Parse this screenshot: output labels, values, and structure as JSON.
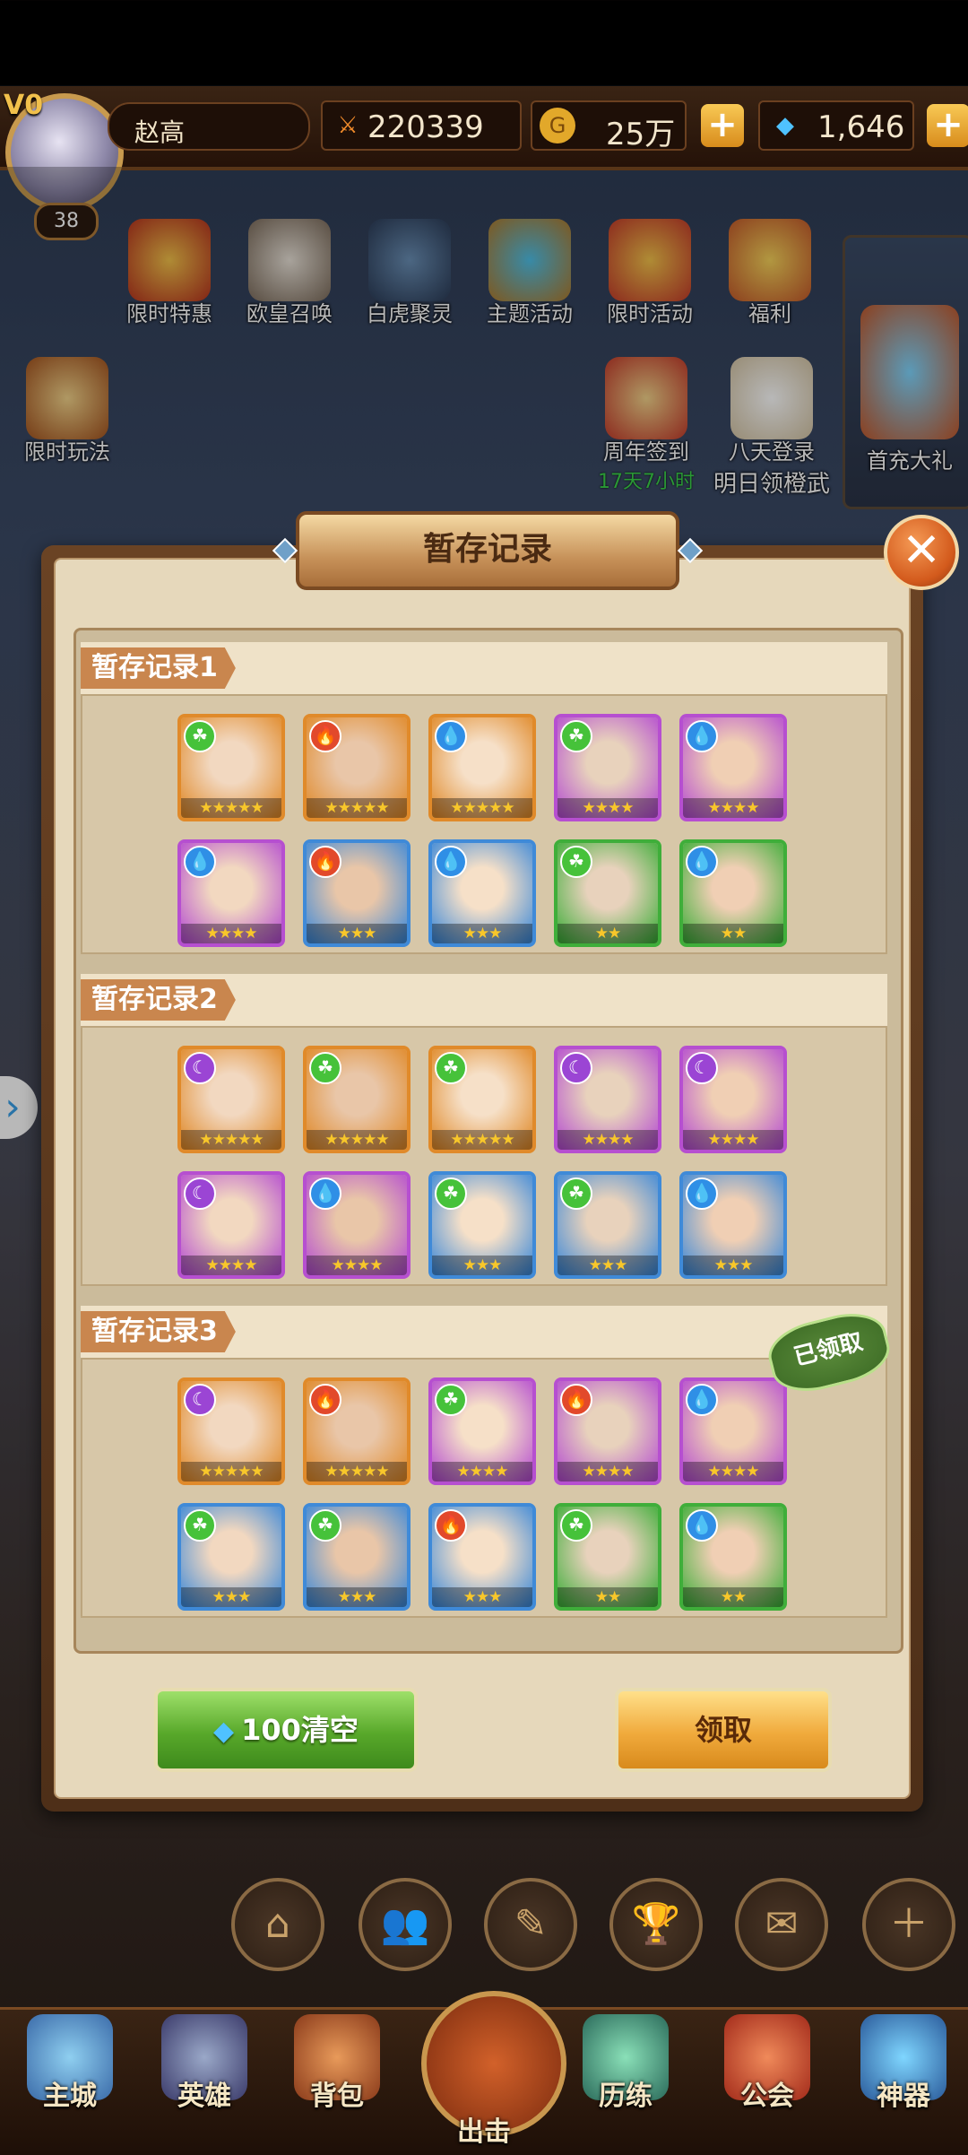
{
  "player": {
    "vip": "V0",
    "name": "赵高",
    "level": "38"
  },
  "resources": {
    "power": "220339",
    "gold": "25万",
    "diamonds": "1,646"
  },
  "activities": [
    {
      "label": "限时特惠"
    },
    {
      "label": "欧皇召唤"
    },
    {
      "label": "白虎聚灵"
    },
    {
      "label": "主题活动"
    },
    {
      "label": "限时活动"
    },
    {
      "label": "福利"
    }
  ],
  "activities2": {
    "limited_play": "限时玩法",
    "anniversary": "周年签到",
    "anniversary_timer": "17天7小时",
    "eight_day": "八天登录",
    "eight_day_sub": "明日领橙武",
    "first_recharge": "首充大礼"
  },
  "dialog": {
    "title": "暂存记录",
    "records": [
      {
        "label": "暂存记录1",
        "claimed": false,
        "heroes": [
          {
            "element": "wind",
            "stars": 5,
            "frame": "orange"
          },
          {
            "element": "fire",
            "stars": 5,
            "frame": "orange"
          },
          {
            "element": "water",
            "stars": 5,
            "frame": "orange"
          },
          {
            "element": "wind",
            "stars": 4,
            "frame": "purple"
          },
          {
            "element": "water",
            "stars": 4,
            "frame": "purple"
          },
          {
            "element": "water",
            "stars": 4,
            "frame": "purple"
          },
          {
            "element": "fire",
            "stars": 3,
            "frame": "blue"
          },
          {
            "element": "water",
            "stars": 3,
            "frame": "blue"
          },
          {
            "element": "wind",
            "stars": 2,
            "frame": "green"
          },
          {
            "element": "water",
            "stars": 2,
            "frame": "green"
          }
        ]
      },
      {
        "label": "暂存记录2",
        "claimed": false,
        "heroes": [
          {
            "element": "dark",
            "stars": 5,
            "frame": "orange"
          },
          {
            "element": "wind",
            "stars": 5,
            "frame": "orange"
          },
          {
            "element": "wind",
            "stars": 5,
            "frame": "orange"
          },
          {
            "element": "dark",
            "stars": 4,
            "frame": "purple"
          },
          {
            "element": "dark",
            "stars": 4,
            "frame": "purple"
          },
          {
            "element": "dark",
            "stars": 4,
            "frame": "purple"
          },
          {
            "element": "water",
            "stars": 4,
            "frame": "purple"
          },
          {
            "element": "wind",
            "stars": 3,
            "frame": "blue"
          },
          {
            "element": "wind",
            "stars": 3,
            "frame": "blue"
          },
          {
            "element": "water",
            "stars": 3,
            "frame": "blue"
          }
        ]
      },
      {
        "label": "暂存记录3",
        "claimed": true,
        "claimed_label": "已领取",
        "heroes": [
          {
            "element": "dark",
            "stars": 5,
            "frame": "orange"
          },
          {
            "element": "fire",
            "stars": 5,
            "frame": "orange"
          },
          {
            "element": "wind",
            "stars": 4,
            "frame": "purple"
          },
          {
            "element": "fire",
            "stars": 4,
            "frame": "purple"
          },
          {
            "element": "water",
            "stars": 4,
            "frame": "purple"
          },
          {
            "element": "wind",
            "stars": 3,
            "frame": "blue"
          },
          {
            "element": "wind",
            "stars": 3,
            "frame": "blue"
          },
          {
            "element": "fire",
            "stars": 3,
            "frame": "blue"
          },
          {
            "element": "wind",
            "stars": 2,
            "frame": "green"
          },
          {
            "element": "water",
            "stars": 2,
            "frame": "green"
          }
        ]
      }
    ],
    "clear_button": "100清空",
    "claim_button": "领取"
  },
  "bottom_nav": [
    {
      "label": "主城"
    },
    {
      "label": "英雄"
    },
    {
      "label": "背包"
    },
    {
      "label": "出击"
    },
    {
      "label": "历练"
    },
    {
      "label": "公会"
    },
    {
      "label": "神器"
    }
  ],
  "colors": {
    "frame_orange": "#e08a2a",
    "frame_purple": "#b64fd0",
    "frame_blue": "#3f8ad8",
    "frame_green": "#3fae3a",
    "wind": "#46c23a",
    "fire": "#e2492b",
    "water": "#2f8fe6",
    "dark": "#9b45d4"
  }
}
